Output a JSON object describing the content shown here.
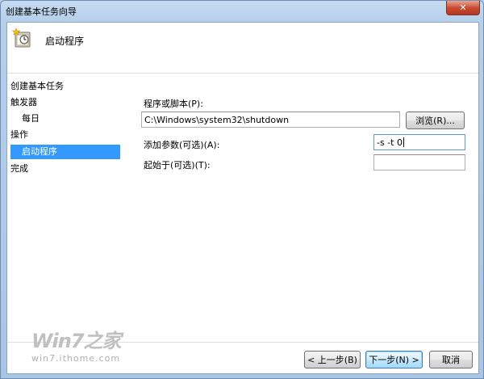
{
  "window": {
    "title": "创建基本任务向导",
    "close_glyph": "✕"
  },
  "header": {
    "title": "启动程序",
    "icon": "task-scheduler-icon"
  },
  "sidebar": {
    "title": "创建基本任务",
    "items": [
      {
        "label": "触发器",
        "sub": false,
        "selected": false
      },
      {
        "label": "每日",
        "sub": true,
        "selected": false
      },
      {
        "label": "操作",
        "sub": false,
        "selected": false
      },
      {
        "label": "启动程序",
        "sub": true,
        "selected": true
      },
      {
        "label": "完成",
        "sub": false,
        "selected": false
      }
    ]
  },
  "form": {
    "program_label": "程序或脚本(P):",
    "program_value": "C:\\Windows\\system32\\shutdown",
    "browse_label": "浏览(R)...",
    "args_label": "添加参数(可选)(A):",
    "args_value": "-s -t 0",
    "startin_label": "起始于(可选)(T):",
    "startin_value": ""
  },
  "footer": {
    "back_label": "< 上一步(B)",
    "next_label": "下一步(N) >",
    "cancel_label": "取消"
  },
  "watermark": {
    "logo": "Win7之家",
    "url": "win7.ithome.com"
  },
  "colors": {
    "selection": "#3399ff",
    "titlebar": "#b9d1ea",
    "close": "#c8472f"
  }
}
